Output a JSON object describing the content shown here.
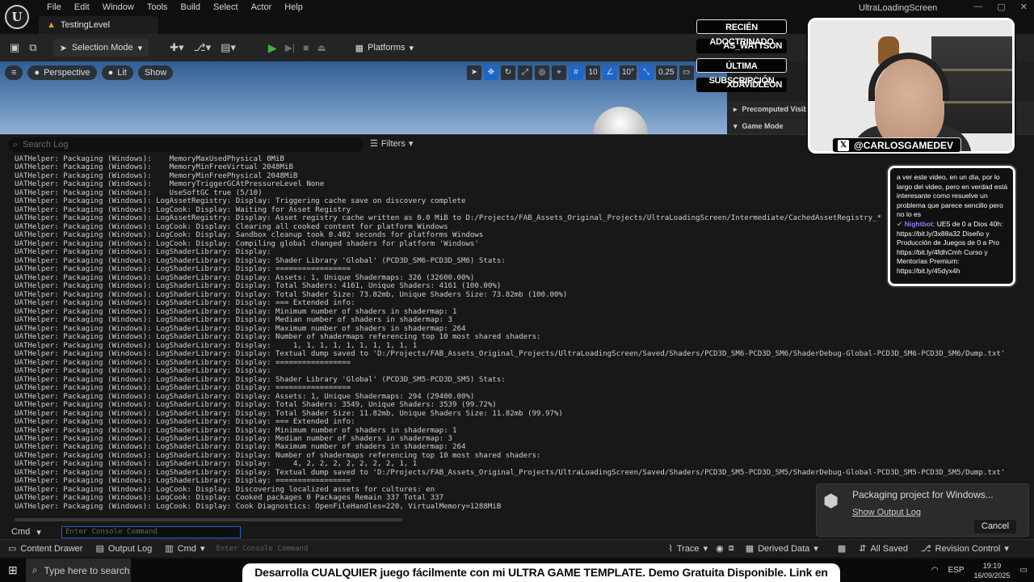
{
  "app": {
    "window_title": "UltraLoadingScreen",
    "level_tab": "TestingLevel",
    "logo_glyph": "U"
  },
  "menu": [
    "File",
    "Edit",
    "Window",
    "Tools",
    "Build",
    "Select",
    "Actor",
    "Help"
  ],
  "toolbar": {
    "mode_label": "Selection Mode",
    "platforms_label": "Platforms"
  },
  "viewport": {
    "perspective_label": "Perspective",
    "lit_label": "Lit",
    "show_label": "Show",
    "grid_size": "10",
    "rotation_snap": "10°",
    "scale_snap": "0,25"
  },
  "details_panel": {
    "row1": "Precomputed Visibility",
    "row2": "Game Mode"
  },
  "output_log": {
    "search_placeholder": "Search Log",
    "filters_label": "Filters",
    "lines": [
      "UATHelper: Packaging (Windows):    MemoryMaxUsedPhysical 0MiB",
      "UATHelper: Packaging (Windows):    MemoryMinFreeVirtual 2048MiB",
      "UATHelper: Packaging (Windows):    MemoryMinFreePhysical 2048MiB",
      "UATHelper: Packaging (Windows):    MemoryTriggerGCAtPressureLevel None",
      "UATHelper: Packaging (Windows):    UseSoftGC true (5/10)",
      "UATHelper: Packaging (Windows): LogAssetRegistry: Display: Triggering cache save on discovery complete",
      "UATHelper: Packaging (Windows): LogCook: Display: Waiting for Asset Registry",
      "UATHelper: Packaging (Windows): LogAssetRegistry: Display: Asset registry cache written as 0.0 MiB to D:/Projects/FAB_Assets_Original_Projects/UltraLoadingScreen/Intermediate/CachedAssetRegistry_*",
      "UATHelper: Packaging (Windows): LogCook: Display: Clearing all cooked content for platform Windows",
      "UATHelper: Packaging (Windows): LogCook: Display: Sandbox cleanup took 0.402 seconds for platforms Windows",
      "UATHelper: Packaging (Windows): LogCook: Display: Compiling global changed shaders for platform 'Windows'",
      "UATHelper: Packaging (Windows): LogShaderLibrary: Display:",
      "UATHelper: Packaging (Windows): LogShaderLibrary: Display: Shader Library 'Global' (PCD3D_SM6-PCD3D_SM6) Stats:",
      "UATHelper: Packaging (Windows): LogShaderLibrary: Display: =================",
      "UATHelper: Packaging (Windows): LogShaderLibrary: Display: Assets: 1, Unique Shadermaps: 326 (32600.00%)",
      "UATHelper: Packaging (Windows): LogShaderLibrary: Display: Total Shaders: 4161, Unique Shaders: 4161 (100.00%)",
      "UATHelper: Packaging (Windows): LogShaderLibrary: Display: Total Shader Size: 73.82mb, Unique Shaders Size: 73.82mb (100.00%)",
      "UATHelper: Packaging (Windows): LogShaderLibrary: Display: === Extended info:",
      "UATHelper: Packaging (Windows): LogShaderLibrary: Display: Minimum number of shaders in shadermap: 1",
      "UATHelper: Packaging (Windows): LogShaderLibrary: Display: Median number of shaders in shadermap: 3",
      "UATHelper: Packaging (Windows): LogShaderLibrary: Display: Maximum number of shaders in shadermap: 264",
      "UATHelper: Packaging (Windows): LogShaderLibrary: Display: Number of shadermaps referencing top 10 most shared shaders:",
      "UATHelper: Packaging (Windows): LogShaderLibrary: Display:     1, 1, 1, 1, 1, 1, 1, 1, 1, 1",
      "UATHelper: Packaging (Windows): LogShaderLibrary: Display: Textual dump saved to 'D:/Projects/FAB_Assets_Original_Projects/UltraLoadingScreen/Saved/Shaders/PCD3D_SM6-PCD3D_SM6/ShaderDebug-Global-PCD3D_SM6-PCD3D_SM6/Dump.txt'",
      "UATHelper: Packaging (Windows): LogShaderLibrary: Display: =================",
      "UATHelper: Packaging (Windows): LogShaderLibrary: Display:",
      "UATHelper: Packaging (Windows): LogShaderLibrary: Display: Shader Library 'Global' (PCD3D_SM5-PCD3D_SM5) Stats:",
      "UATHelper: Packaging (Windows): LogShaderLibrary: Display: =================",
      "UATHelper: Packaging (Windows): LogShaderLibrary: Display: Assets: 1, Unique Shadermaps: 294 (29400.00%)",
      "UATHelper: Packaging (Windows): LogShaderLibrary: Display: Total Shaders: 3549, Unique Shaders: 3539 (99.72%)",
      "UATHelper: Packaging (Windows): LogShaderLibrary: Display: Total Shader Size: 11.82mb, Unique Shaders Size: 11.82mb (99.97%)",
      "UATHelper: Packaging (Windows): LogShaderLibrary: Display: === Extended info:",
      "UATHelper: Packaging (Windows): LogShaderLibrary: Display: Minimum number of shaders in shadermap: 1",
      "UATHelper: Packaging (Windows): LogShaderLibrary: Display: Median number of shaders in shadermap: 3",
      "UATHelper: Packaging (Windows): LogShaderLibrary: Display: Maximum number of shaders in shadermap: 264",
      "UATHelper: Packaging (Windows): LogShaderLibrary: Display: Number of shadermaps referencing top 10 most shared shaders:",
      "UATHelper: Packaging (Windows): LogShaderLibrary: Display:     4, 2, 2, 2, 2, 2, 2, 2, 1, 1",
      "UATHelper: Packaging (Windows): LogShaderLibrary: Display: Textual dump saved to 'D:/Projects/FAB_Assets_Original_Projects/UltraLoadingScreen/Saved/Shaders/PCD3D_SM5-PCD3D_SM5/ShaderDebug-Global-PCD3D_SM5-PCD3D_SM5/Dump.txt'",
      "UATHelper: Packaging (Windows): LogShaderLibrary: Display: =================",
      "UATHelper: Packaging (Windows): LogCook: Display: Discovering localized assets for cultures: en",
      "UATHelper: Packaging (Windows): LogCook: Display: Cooked packages 0 Packages Remain 337 Total 337",
      "UATHelper: Packaging (Windows): LogCook: Display: Cook Diagnostics: OpenFileHandles=220, VirtualMemory=1288MiB"
    ],
    "cmd_label": "Cmd",
    "console_placeholder": "Enter Console Command"
  },
  "statusbar": {
    "content_drawer": "Content Drawer",
    "output_log": "Output Log",
    "cmd": "Cmd",
    "console_placeholder": "Enter Console Command",
    "trace": "Trace",
    "derived_data": "Derived Data",
    "all_saved": "All Saved",
    "revision_control": "Revision Control"
  },
  "toast": {
    "title": "Packaging project for Windows...",
    "link": "Show Output Log",
    "cancel": "Cancel"
  },
  "stream_overlay": {
    "credits": [
      "RECIÉN ADOCTRINADO",
      "AS_WATTSON",
      "ÚLTIMA SUBSCRIPCIÓN",
      "XDAVIDLEON"
    ],
    "handle": "@CARLOSGAMEDEV",
    "chat_message": "a ver este video, en un día, por lo largo del video, pero en verdad está interesante como resuelve un problema que parece sencillo pero no lo es",
    "bot_name": "Nightbot",
    "bot_message": "UE5 de 0 a Dios 40h: https://bit.ly/3x88a32 Diseño y Producción de Juegos de 0 a Pro https://bit.ly/4fdhCmh Curso y Mentorías Premium: https://bit.ly/45dyx4h",
    "promo_banner": "Desarrolla CUALQUIER juego fácilmente con mi ULTRA GAME TEMPLATE. Demo Gratuita Disponible. Link en Descripción."
  },
  "taskbar": {
    "search_placeholder": "Type here to search",
    "language": "ESP",
    "time": "19:19",
    "date": "16/09/2025"
  },
  "colors": {
    "accent": "#1f66c9",
    "play_green": "#43b244",
    "level_icon_orange": "#e59a2c"
  }
}
